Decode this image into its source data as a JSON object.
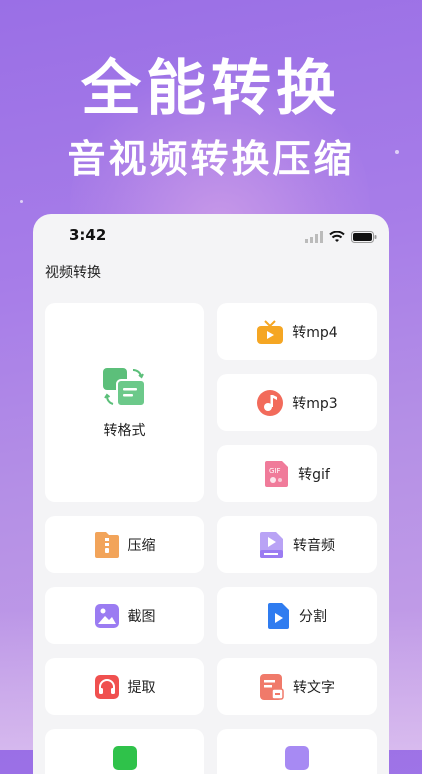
{
  "promo": {
    "headline": "全能转换",
    "subheadline": "音视频转换压缩"
  },
  "status_bar": {
    "time": "3:42"
  },
  "page": {
    "title": "视频转换"
  },
  "tiles": {
    "format": {
      "label": "转格式",
      "icon": "format-convert-icon",
      "color": "#5cbf7a"
    },
    "mp4": {
      "label": "转mp4",
      "icon": "tv-icon",
      "color": "#f5a623"
    },
    "mp3": {
      "label": "转mp3",
      "icon": "music-note-icon",
      "color": "#f26b5b"
    },
    "gif": {
      "label": "转gif",
      "icon": "gif-icon",
      "color": "#f07b9a"
    },
    "compress": {
      "label": "压缩",
      "icon": "zip-file-icon",
      "color": "#f2a45a"
    },
    "audio": {
      "label": "转音频",
      "icon": "audio-file-icon",
      "color": "#9b7cf2"
    },
    "screenshot": {
      "label": "截图",
      "icon": "image-icon",
      "color": "#9b7cf2"
    },
    "split": {
      "label": "分割",
      "icon": "split-file-icon",
      "color": "#2f7cf0"
    },
    "extract": {
      "label": "提取",
      "icon": "headphones-icon",
      "color": "#f0504f"
    },
    "text": {
      "label": "转文字",
      "icon": "text-file-icon",
      "color": "#f07a6a"
    }
  }
}
